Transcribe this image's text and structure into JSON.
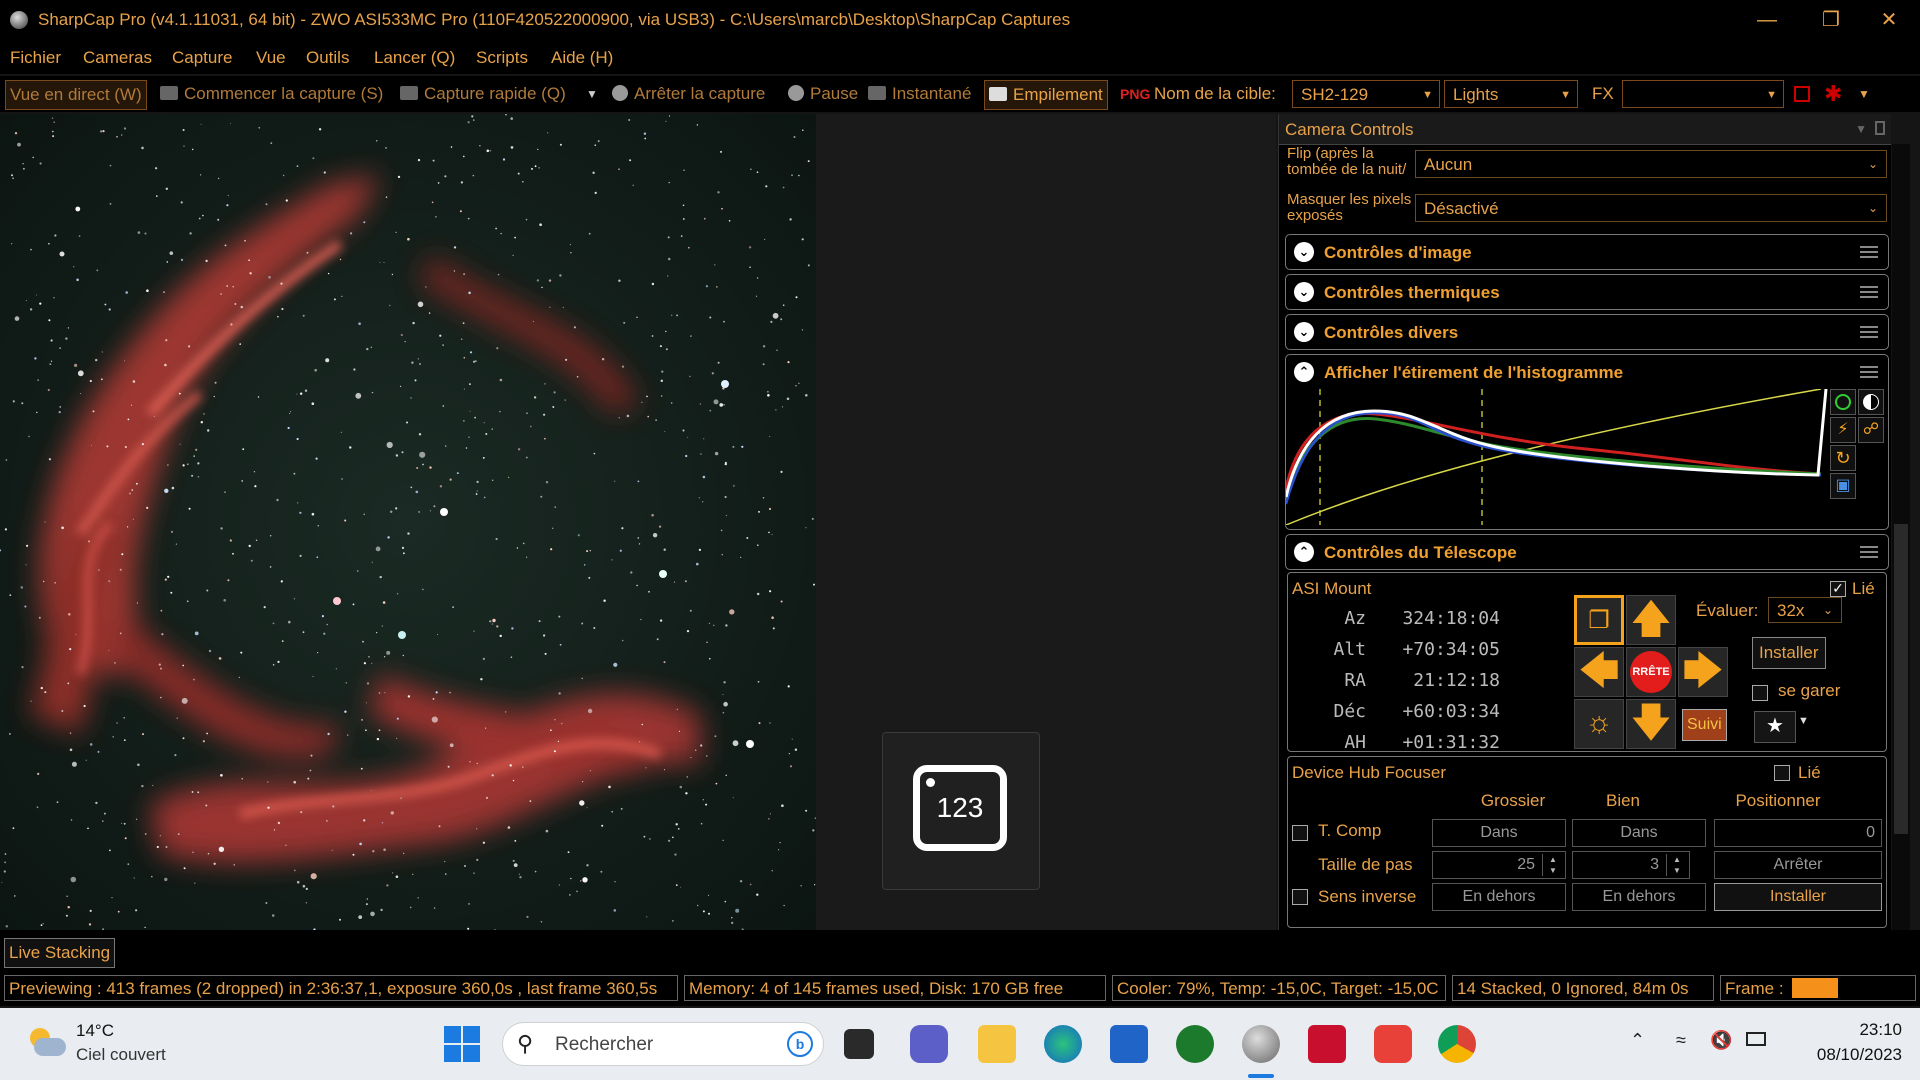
{
  "window": {
    "title": "SharpCap Pro (v4.1.11031, 64 bit) - ZWO ASI533MC Pro (110F420522000900, via USB3) - C:\\Users\\marcb\\Desktop\\SharpCap Captures",
    "controls": [
      "minimize",
      "restore",
      "close"
    ]
  },
  "menu": [
    "Fichier",
    "Cameras",
    "Capture",
    "Vue",
    "Outils",
    "Lancer (Q)",
    "Scripts",
    "Aide (H)"
  ],
  "toolbar": {
    "live_view": "Vue en direct (W)",
    "start_capture": "Commencer la capture (S)",
    "quick_capture": "Capture rapide (Q)",
    "stop_capture": "Arrêter la capture",
    "pause": "Pause",
    "snapshot": "Instantané",
    "stacking": "Empilement",
    "target_label": "Nom de la cible:",
    "target_value": "SH2-129",
    "frame_type": "Lights",
    "fx_label": "FX",
    "fx_value": ""
  },
  "counter_widget": {
    "value": "123"
  },
  "panel": {
    "title": "Camera Controls",
    "flip_label": "Flip (après la tombée de la nuit/à plat)",
    "flip_value": "Aucun",
    "mask_label": "Masquer les pixels exposés",
    "mask_value": "Désactivé",
    "sections": {
      "image": "Contrôles d'image",
      "thermal": "Contrôles thermiques",
      "misc": "Contrôles divers",
      "histogram": "Afficher l'étirement de l'histogramme",
      "telescope": "Contrôles du Télescope"
    },
    "mount": {
      "name": "ASI Mount",
      "linked_label": "Lié",
      "linked": true,
      "coords": [
        {
          "label": "Az",
          "value": "324:18:04"
        },
        {
          "label": "Alt",
          "value": "+70:34:05"
        },
        {
          "label": "RA",
          "value": "21:12:18"
        },
        {
          "label": "Déc",
          "value": "+60:03:34"
        },
        {
          "label": "AH",
          "value": "+01:31:32"
        }
      ],
      "stop_label": "RRÊTE",
      "rate_label": "Évaluer:",
      "rate_value": "32x",
      "install_label": "Installer",
      "park_label": "se garer",
      "track_label": "Suivi"
    },
    "focuser": {
      "name": "Device Hub Focuser",
      "linked_label": "Lié",
      "linked": false,
      "col_coarse": "Grossier",
      "col_fine": "Bien",
      "col_position": "Positionner",
      "tcomp_label": "T. Comp",
      "in_label": "Dans",
      "position_value": "0",
      "step_label": "Taille de pas",
      "coarse_step": "25",
      "fine_step": "3",
      "stop_label": "Arrêter",
      "reverse_label": "Sens inverse",
      "out_label": "En dehors",
      "install_label": "Installer"
    }
  },
  "bottom": {
    "tab": "Live Stacking",
    "status_preview": "Previewing : 413 frames (2 dropped) in 2:36:37,1, exposure 360,0s , last frame 360,5s",
    "status_memory": "Memory: 4 of 145 frames used, Disk: 170 GB free",
    "status_cooler": "Cooler: 79%, Temp: -15,0C, Target: -15,0C",
    "status_stack": "14 Stacked, 0 Ignored, 84m 0s",
    "status_frame": "Frame :"
  },
  "taskbar": {
    "weather_temp": "14°C",
    "weather_desc": "Ciel couvert",
    "search_placeholder": "Rechercher",
    "time": "23:10",
    "date": "08/10/2023"
  },
  "colors": {
    "accent": "#e8a24a",
    "section_title": "#f0a030",
    "arrow": "#f5a21d",
    "stop_button": "#e31c1c"
  }
}
